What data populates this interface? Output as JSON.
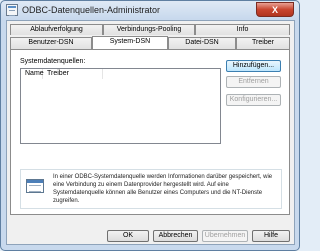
{
  "window": {
    "title": "ODBC-Datenquellen-Administrator",
    "close_glyph": "X"
  },
  "tabs_row1": [
    "Ablaufverfolgung",
    "Verbindungs-Pooling",
    "Info"
  ],
  "tabs_row2": [
    "Benutzer-DSN",
    "System-DSN",
    "Datei-DSN",
    "Treiber"
  ],
  "active_tab": "System-DSN",
  "system_dsn": {
    "label": "Systemdatenquellen:",
    "columns": [
      "Name",
      "Treiber"
    ],
    "rows": [],
    "buttons": {
      "add": "Hinzufügen...",
      "remove": "Entfernen",
      "configure": "Konfigurieren..."
    },
    "info": "In einer ODBC-Systemdatenquelle werden Informationen darüber gespeichert, wie eine Verbindung zu einem Datenprovider hergestellt wird. Auf eine Systemdatenquelle können alle Benutzer eines Computers und die NT-Dienste zugreifen."
  },
  "footer": {
    "ok": "OK",
    "cancel": "Abbrechen",
    "apply": "Übernehmen",
    "help": "Hilfe"
  }
}
